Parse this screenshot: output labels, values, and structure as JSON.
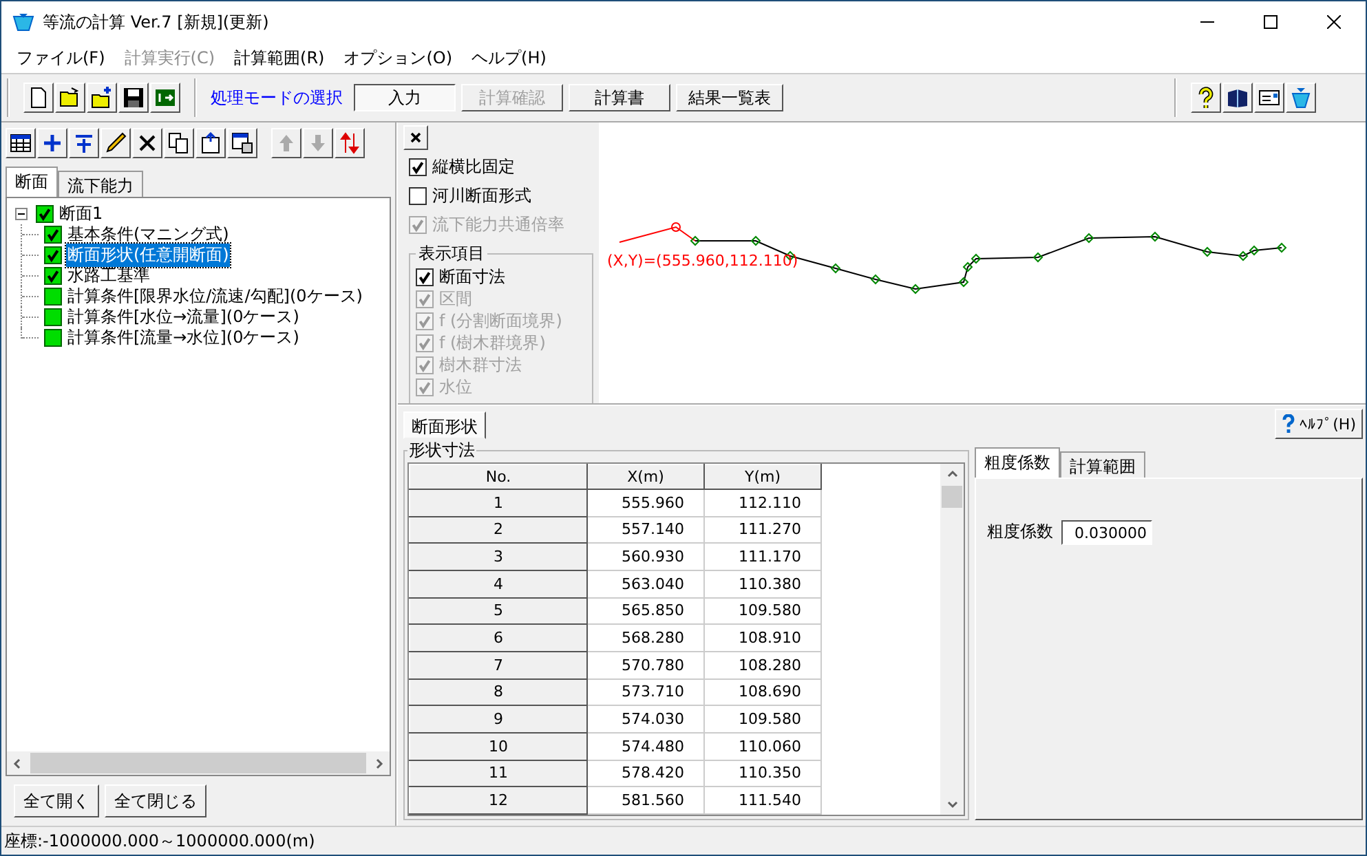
{
  "window": {
    "title": "等流の計算 Ver.7 [新規](更新)"
  },
  "menu": [
    {
      "label": "ファイル(F)",
      "disabled": false
    },
    {
      "label": "計算実行(C)",
      "disabled": true
    },
    {
      "label": "計算範囲(R)",
      "disabled": false
    },
    {
      "label": "オプション(O)",
      "disabled": false
    },
    {
      "label": "ヘルプ(H)",
      "disabled": false
    }
  ],
  "toolbar": {
    "mode_label": "処理モードの選択",
    "modes": [
      {
        "label": "入力",
        "selected": true,
        "disabled": false
      },
      {
        "label": "計算確認",
        "selected": false,
        "disabled": true
      },
      {
        "label": "計算書",
        "selected": false,
        "disabled": false
      },
      {
        "label": "結果一覧表",
        "selected": false,
        "disabled": false
      }
    ]
  },
  "tree_tabs": [
    {
      "label": "断面",
      "selected": true
    },
    {
      "label": "流下能力",
      "selected": false
    }
  ],
  "tree": [
    {
      "label": "断面1",
      "checked": true,
      "selected": false,
      "expanded": true,
      "children": [
        {
          "label": "基本条件(マニング式)",
          "checked": true,
          "selected": false
        },
        {
          "label": "断面形状(任意開断面)",
          "checked": true,
          "selected": true
        },
        {
          "label": "水路工基準",
          "checked": true,
          "selected": false
        },
        {
          "label": "計算条件[限界水位/流速/勾配](0ケース)",
          "checked": false,
          "selected": false
        },
        {
          "label": "計算条件[水位→流量](0ケース)",
          "checked": false,
          "selected": false
        },
        {
          "label": "計算条件[流量→水位](0ケース)",
          "checked": false,
          "selected": false
        }
      ]
    }
  ],
  "tree_buttons": [
    "全て開く",
    "全て閉じる"
  ],
  "view_options": [
    {
      "label": "縦横比固定",
      "checked": true,
      "disabled": false
    },
    {
      "label": "河川断面形式",
      "checked": false,
      "disabled": false
    },
    {
      "label": "流下能力共通倍率",
      "checked": true,
      "disabled": true
    }
  ],
  "display_items": {
    "title": "表示項目",
    "items": [
      {
        "label": "断面寸法",
        "checked": true,
        "disabled": false
      },
      {
        "label": "区間",
        "checked": true,
        "disabled": true
      },
      {
        "label": "f (分割断面境界)",
        "checked": true,
        "disabled": true
      },
      {
        "label": "f (樹木群境界)",
        "checked": true,
        "disabled": true
      },
      {
        "label": "樹木群寸法",
        "checked": true,
        "disabled": true
      },
      {
        "label": "水位",
        "checked": true,
        "disabled": true
      }
    ]
  },
  "profile": {
    "coordinate_label": "(X,Y)=(555.960,112.110)"
  },
  "bottom_tabs": [
    {
      "label": "断面形状",
      "selected": true
    }
  ],
  "help_button": "ﾍﾙﾌﾟ(H)",
  "shape_table": {
    "title": "形状寸法",
    "columns": [
      "No.",
      "X(m)",
      "Y(m)"
    ],
    "rows": [
      [
        "1",
        "555.960",
        "112.110"
      ],
      [
        "2",
        "557.140",
        "111.270"
      ],
      [
        "3",
        "560.930",
        "111.170"
      ],
      [
        "4",
        "563.040",
        "110.380"
      ],
      [
        "5",
        "565.850",
        "109.580"
      ],
      [
        "6",
        "568.280",
        "108.910"
      ],
      [
        "7",
        "570.780",
        "108.280"
      ],
      [
        "8",
        "573.710",
        "108.690"
      ],
      [
        "9",
        "574.030",
        "109.580"
      ],
      [
        "10",
        "574.480",
        "110.060"
      ],
      [
        "11",
        "578.420",
        "110.350"
      ],
      [
        "12",
        "581.560",
        "111.540"
      ]
    ]
  },
  "side_tabs": [
    {
      "label": "粗度係数",
      "selected": true
    },
    {
      "label": "計算範囲",
      "selected": false
    }
  ],
  "roughness": {
    "label": "粗度係数",
    "value": "0.030000"
  },
  "status_bar": "座標:-1000000.000～1000000.000(m)"
}
